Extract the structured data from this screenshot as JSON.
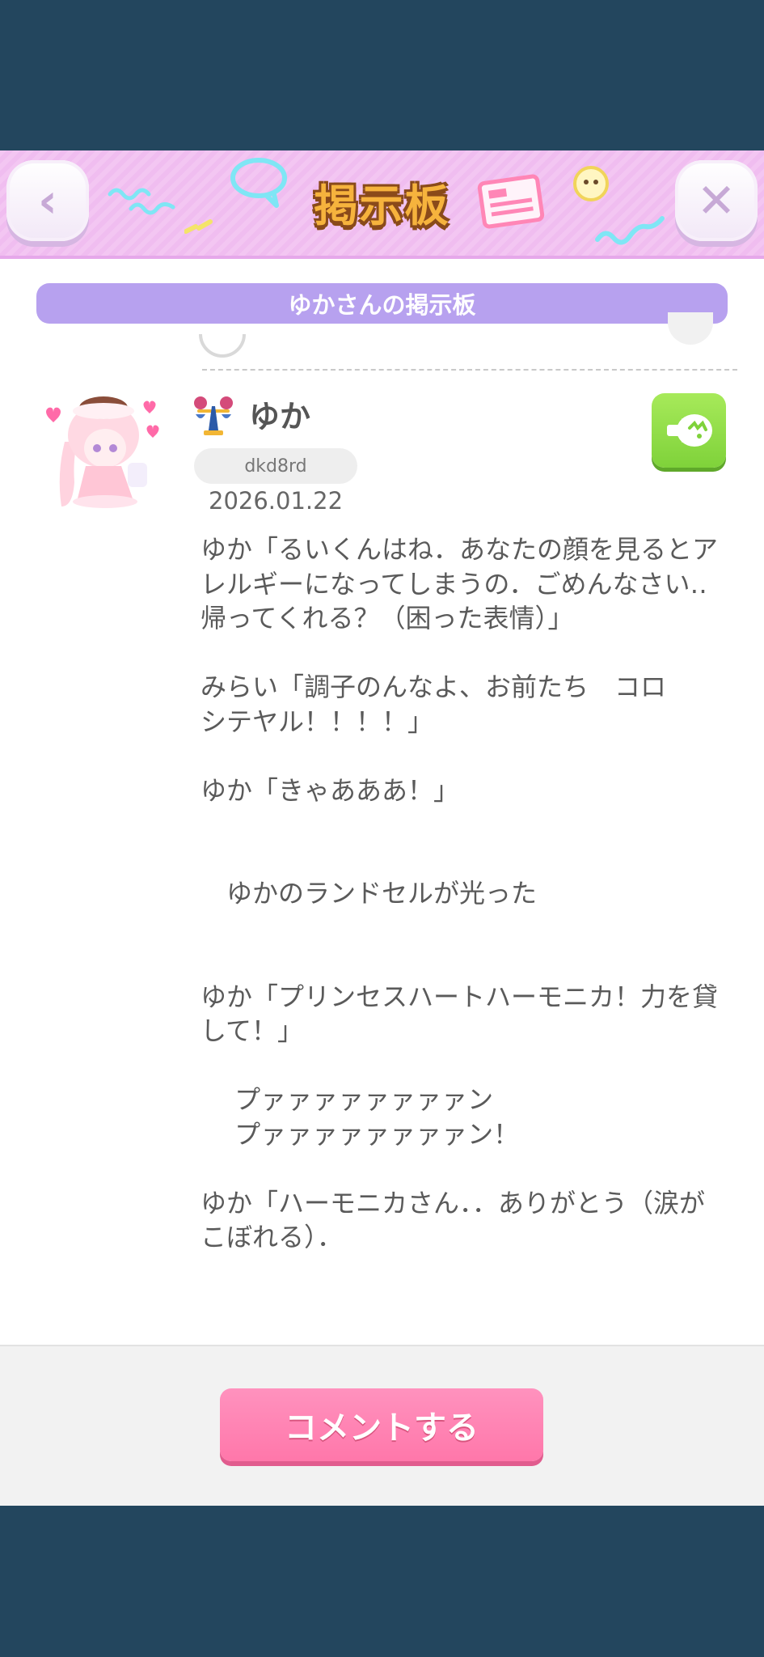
{
  "header": {
    "title": "掲示板",
    "back_icon": "chevron-left-icon",
    "close_icon": "close-icon",
    "back_glyph": "‹",
    "close_glyph": "✕"
  },
  "board": {
    "owner_label": "ゆかさんの掲示板"
  },
  "post": {
    "username": "ゆか",
    "user_id": "dkd8rd",
    "date": "2026.01.22",
    "body": "ゆか「るいくんはね．あなたの顔を見るとアレルギーになってしまうの．ごめんなさい‥帰ってくれる？（困った表情）」\n\nみらい「調子のんなよ、お前たち　コロ\nシテヤル！！！！」\n\nゆか「きゃあああ！」\n\n\n　ゆかのランドセルが光った\n\n\nゆか「プリンセスハートハーモニカ！力を貸して！」\n\n　 プァァァァァァァァン\n　 プァァァァァァァァン！\n\nゆか「ハーモニカさん．．ありがとう（涙がこぼれる）．"
  },
  "footer": {
    "comment_button": "コメントする"
  },
  "colors": {
    "background": "#23465e",
    "header": "#f3c6f2",
    "subbar": "#b7a1ef",
    "green_button": "#8fdc48",
    "comment_button": "#ff85b4"
  }
}
